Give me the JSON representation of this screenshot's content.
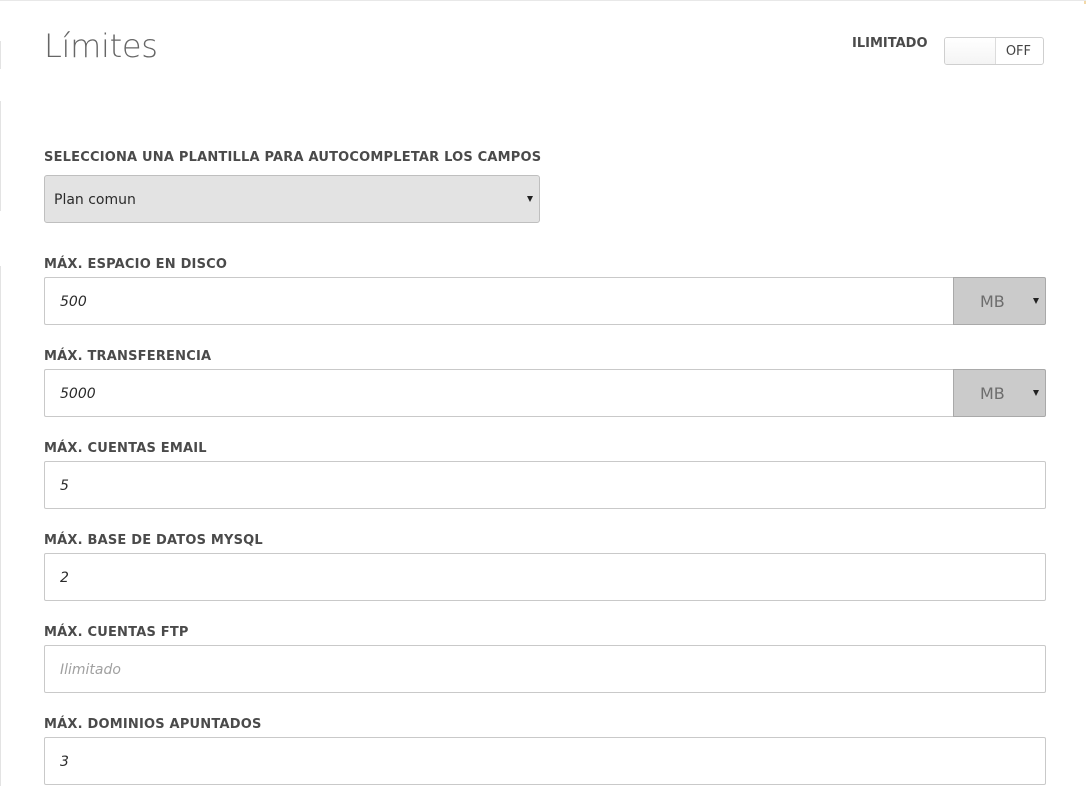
{
  "header": {
    "title": "Límites"
  },
  "unlimited_toggle": {
    "label": "ILIMITADO",
    "state": "OFF"
  },
  "template": {
    "label": "SELECCIONA UNA PLANTILLA PARA AUTOCOMPLETAR LOS CAMPOS",
    "selected": "Plan comun"
  },
  "fields": {
    "disk_space": {
      "label": "MÁX. ESPACIO EN DISCO",
      "value": "500",
      "unit": "MB"
    },
    "transfer": {
      "label": "MÁX. TRANSFERENCIA",
      "value": "5000",
      "unit": "MB"
    },
    "email_accounts": {
      "label": "MÁX. CUENTAS EMAIL",
      "value": "5"
    },
    "mysql_databases": {
      "label": "MÁX. BASE DE DATOS MYSQL",
      "value": "2"
    },
    "ftp_accounts": {
      "label": "MÁX. CUENTAS FTP",
      "value": "",
      "placeholder": "Ilimitado"
    },
    "pointed_domains": {
      "label": "MÁX. DOMINIOS APUNTADOS",
      "value": "3"
    }
  }
}
